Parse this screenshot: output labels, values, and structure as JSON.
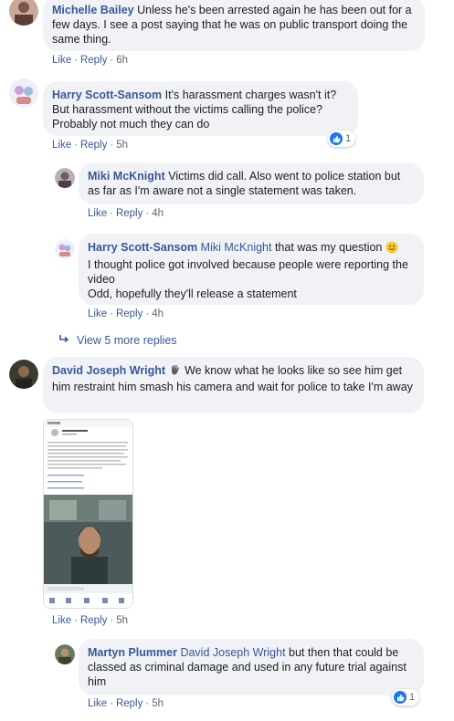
{
  "comments": [
    {
      "author": "Michelle Bailey",
      "text": "Unless he's been arrested again he has been out for a few days. I see a post saying that he was on public transport doing the same thing.",
      "actions": {
        "like": "Like",
        "reply": "Reply",
        "time": "6h"
      }
    },
    {
      "author": "Harry Scott-Sansom",
      "text": "It's harassment charges wasn't it? But harassment without the victims calling the police? Probably not much they can do",
      "reaction_count": "1",
      "actions": {
        "like": "Like",
        "reply": "Reply",
        "time": "5h"
      },
      "replies": [
        {
          "author": "Miki McKnight",
          "text": "Victims did call. Also went to police station but as far as I'm aware not a single statement was taken.",
          "actions": {
            "like": "Like",
            "reply": "Reply",
            "time": "4h"
          }
        },
        {
          "author": "Harry Scott-Sansom",
          "mention": "Miki McKnight",
          "text_line1": "that was my question",
          "text_rest": "I thought police got involved because people were reporting the video",
          "text_last": "Odd, hopefully they'll release a statement",
          "actions": {
            "like": "Like",
            "reply": "Reply",
            "time": "4h"
          }
        }
      ],
      "view_more": "View 5 more replies"
    },
    {
      "author": "David Joseph Wright",
      "text": "We know what he looks like so see him get him restraint him smash his camera and wait for police to take I'm away",
      "actions": {
        "like": "Like",
        "reply": "Reply",
        "time": "5h"
      },
      "replies": [
        {
          "author": "Martyn Plummer",
          "mention": "David Joseph Wright",
          "text": "but then that could be classed as criminal damage and used in any future trial against him",
          "reaction_count": "1",
          "actions": {
            "like": "Like",
            "reply": "Reply",
            "time": "5h"
          }
        }
      ]
    }
  ],
  "colors": {
    "link": "#385898",
    "bubble": "#f0f2f5",
    "like_blue": "#1877f2"
  }
}
